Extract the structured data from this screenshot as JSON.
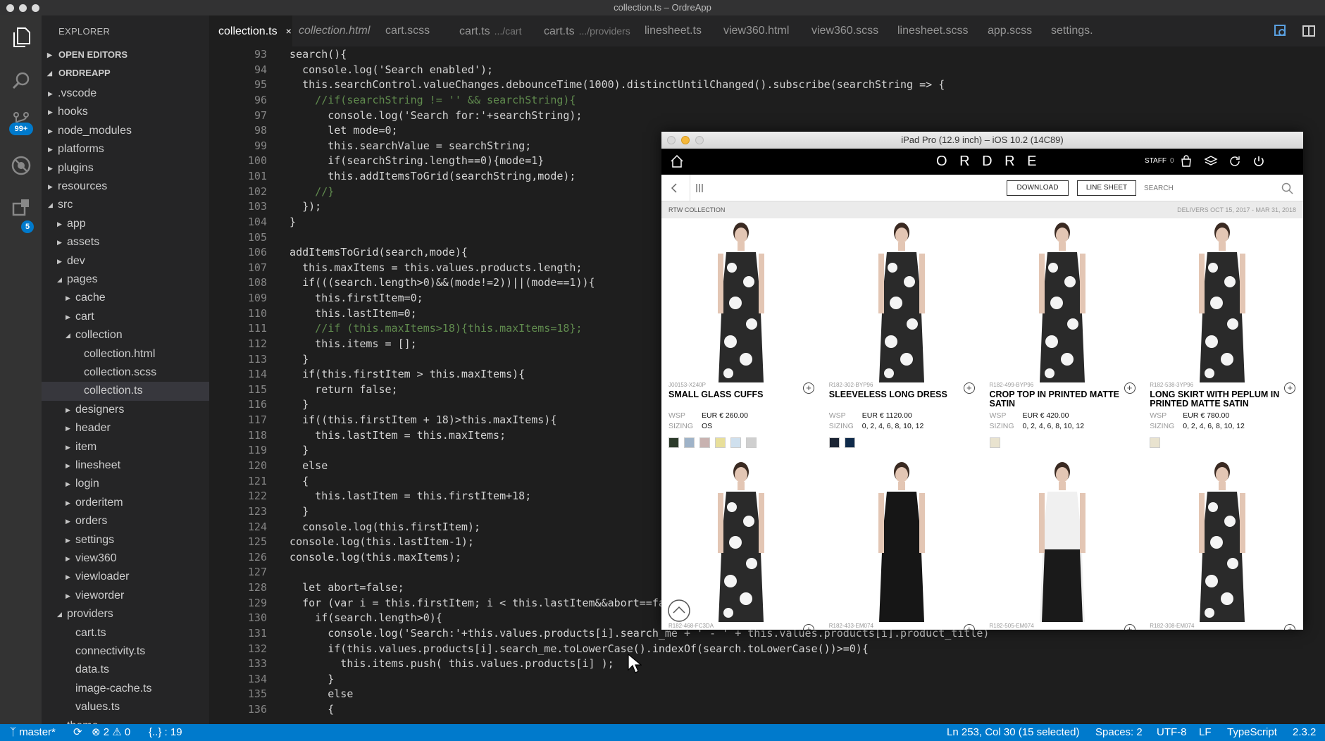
{
  "window": {
    "title": "collection.ts – OrdreApp"
  },
  "activity_bar": {
    "scm_badge": "99+",
    "ext_badge": "5"
  },
  "sidebar": {
    "title": "EXPLORER",
    "open_editors": "OPEN EDITORS",
    "project": "ORDREAPP",
    "tree": [
      {
        "label": ".vscode",
        "depth": 1,
        "kind": "folder",
        "open": false
      },
      {
        "label": "hooks",
        "depth": 1,
        "kind": "folder",
        "open": false
      },
      {
        "label": "node_modules",
        "depth": 1,
        "kind": "folder",
        "open": false
      },
      {
        "label": "platforms",
        "depth": 1,
        "kind": "folder",
        "open": false
      },
      {
        "label": "plugins",
        "depth": 1,
        "kind": "folder",
        "open": false
      },
      {
        "label": "resources",
        "depth": 1,
        "kind": "folder",
        "open": false
      },
      {
        "label": "src",
        "depth": 1,
        "kind": "folder",
        "open": true
      },
      {
        "label": "app",
        "depth": 2,
        "kind": "folder",
        "open": false
      },
      {
        "label": "assets",
        "depth": 2,
        "kind": "folder",
        "open": false
      },
      {
        "label": "dev",
        "depth": 2,
        "kind": "folder",
        "open": false
      },
      {
        "label": "pages",
        "depth": 2,
        "kind": "folder",
        "open": true
      },
      {
        "label": "cache",
        "depth": 3,
        "kind": "folder",
        "open": false
      },
      {
        "label": "cart",
        "depth": 3,
        "kind": "folder",
        "open": false
      },
      {
        "label": "collection",
        "depth": 3,
        "kind": "folder",
        "open": true
      },
      {
        "label": "collection.html",
        "depth": 4,
        "kind": "file"
      },
      {
        "label": "collection.scss",
        "depth": 4,
        "kind": "file"
      },
      {
        "label": "collection.ts",
        "depth": 4,
        "kind": "file",
        "selected": true
      },
      {
        "label": "designers",
        "depth": 3,
        "kind": "folder",
        "open": false
      },
      {
        "label": "header",
        "depth": 3,
        "kind": "folder",
        "open": false
      },
      {
        "label": "item",
        "depth": 3,
        "kind": "folder",
        "open": false
      },
      {
        "label": "linesheet",
        "depth": 3,
        "kind": "folder",
        "open": false
      },
      {
        "label": "login",
        "depth": 3,
        "kind": "folder",
        "open": false
      },
      {
        "label": "orderitem",
        "depth": 3,
        "kind": "folder",
        "open": false
      },
      {
        "label": "orders",
        "depth": 3,
        "kind": "folder",
        "open": false
      },
      {
        "label": "settings",
        "depth": 3,
        "kind": "folder",
        "open": false
      },
      {
        "label": "view360",
        "depth": 3,
        "kind": "folder",
        "open": false
      },
      {
        "label": "viewloader",
        "depth": 3,
        "kind": "folder",
        "open": false
      },
      {
        "label": "vieworder",
        "depth": 3,
        "kind": "folder",
        "open": false
      },
      {
        "label": "providers",
        "depth": 2,
        "kind": "folder",
        "open": true
      },
      {
        "label": "cart.ts",
        "depth": 3,
        "kind": "file"
      },
      {
        "label": "connectivity.ts",
        "depth": 3,
        "kind": "file"
      },
      {
        "label": "data.ts",
        "depth": 3,
        "kind": "file"
      },
      {
        "label": "image-cache.ts",
        "depth": 3,
        "kind": "file"
      },
      {
        "label": "values.ts",
        "depth": 3,
        "kind": "file"
      },
      {
        "label": "theme",
        "depth": 2,
        "kind": "folder",
        "open": false
      }
    ]
  },
  "tabs": [
    {
      "label": "collection.ts",
      "desc": "",
      "active": true,
      "italic": false
    },
    {
      "label": "collection.html",
      "desc": "",
      "active": false,
      "italic": true
    },
    {
      "label": "cart.scss",
      "desc": "",
      "active": false,
      "italic": false
    },
    {
      "label": "cart.ts",
      "desc": ".../cart",
      "active": false,
      "italic": false
    },
    {
      "label": "cart.ts",
      "desc": ".../providers",
      "active": false,
      "italic": false
    },
    {
      "label": "linesheet.ts",
      "desc": "",
      "active": false,
      "italic": false
    },
    {
      "label": "view360.html",
      "desc": "",
      "active": false,
      "italic": false
    },
    {
      "label": "view360.scss",
      "desc": "",
      "active": false,
      "italic": false
    },
    {
      "label": "linesheet.scss",
      "desc": "",
      "active": false,
      "italic": false
    },
    {
      "label": "app.scss",
      "desc": "",
      "active": false,
      "italic": false
    },
    {
      "label": "settings.",
      "desc": "",
      "active": false,
      "italic": false
    }
  ],
  "tab_close_glyph": "×",
  "editor": {
    "first_line": 93,
    "lines": [
      "  search(){",
      "    console.log('Search enabled');",
      "    this.searchControl.valueChanges.debounceTime(1000).distinctUntilChanged().subscribe(searchString => {",
      "      //if(searchString != '' && searchString){",
      "        console.log('Search for:'+searchString);",
      "        let mode=0;",
      "        this.searchValue = searchString;",
      "        if(searchString.length==0){mode=1}",
      "        this.addItemsToGrid(searchString,mode);",
      "      //}",
      "    });",
      "  }",
      "",
      "  addItemsToGrid(search,mode){",
      "    this.maxItems = this.values.products.length;",
      "    if(((search.length>0)&&(mode!=2))||(mode==1)){",
      "      this.firstItem=0;",
      "      this.lastItem=0;",
      "      //if (this.maxItems>18){this.maxItems=18};",
      "      this.items = [];",
      "    }",
      "    if(this.firstItem > this.maxItems){",
      "      return false;",
      "    }",
      "    if((this.firstItem + 18)>this.maxItems){",
      "      this.lastItem = this.maxItems;",
      "    }",
      "    else",
      "    {",
      "      this.lastItem = this.firstItem+18;",
      "    }",
      "    console.log(this.firstItem);",
      "  console.log(this.lastItem-1);",
      "  console.log(this.maxItems);",
      "",
      "    let abort=false;",
      "    for (var i = this.firstItem; i < this.lastItem&&abort==false; i++){",
      "      if(search.length>0){",
      "        console.log('Search:'+this.values.products[i].search_me + ' - ' + this.values.products[i].product_title)",
      "        if(this.values.products[i].search_me.toLowerCase().indexOf(search.toLowerCase())>=0){",
      "          this.items.push( this.values.products[i] );",
      "        }",
      "        else",
      "        {"
    ]
  },
  "simulator": {
    "title": "iPad Pro (12.9 inch) – iOS 10.2 (14C89)",
    "brand": "O R D R E",
    "staff": "STAFF",
    "cart_count": "0",
    "download": "DOWNLOAD",
    "line_sheet": "LINE SHEET",
    "search_placeholder": "SEARCH",
    "collection_label": "RTW COLLECTION",
    "delivers": "DELIVERS OCT 15, 2017 - MAR 31, 2018",
    "wsp_label": "WSP",
    "sizing_label": "SIZING",
    "products": [
      {
        "code": "J00153-X240P",
        "name": "SMALL GLASS CUFFS",
        "wsp": "EUR € 260.00",
        "sizing": "OS",
        "swatches": [
          "#2b3a2a",
          "#9fb3c8",
          "#c8b2b0",
          "#e8df9a",
          "#cfe0ee",
          "#cfcfcf"
        ]
      },
      {
        "code": "R182-302-BYP96",
        "name": "SLEEVELESS LONG DRESS",
        "wsp": "EUR € 1120.00",
        "sizing": "0, 2, 4, 6, 8, 10, 12",
        "swatches": [
          "#1b2433",
          "#0f2a4a"
        ]
      },
      {
        "code": "R182-499-BYP96",
        "name": "CROP TOP IN PRINTED MATTE SATIN",
        "wsp": "EUR € 420.00",
        "sizing": "0, 2, 4, 6, 8, 10, 12",
        "swatches": [
          "#e9e3cf"
        ]
      },
      {
        "code": "R182-538-3YP96",
        "name": "LONG SKIRT WITH PEPLUM IN PRINTED MATTE SATIN",
        "wsp": "EUR € 780.00",
        "sizing": "0, 2, 4, 6, 8, 10, 12",
        "swatches": [
          "#e9e3cf"
        ]
      },
      {
        "code": "R182-468-FC3DA",
        "name": "",
        "wsp": "",
        "sizing": "",
        "swatches": []
      },
      {
        "code": "R182-433-EM074",
        "name": "",
        "wsp": "",
        "sizing": "",
        "swatches": []
      },
      {
        "code": "R182-505-EM074",
        "name": "",
        "wsp": "",
        "sizing": "",
        "swatches": []
      },
      {
        "code": "R182-308-EM074",
        "name": "",
        "wsp": "",
        "sizing": "",
        "swatches": []
      }
    ]
  },
  "status_bar": {
    "branch": "master*",
    "errors": "2",
    "warnings": "0",
    "braces": "{..} : 19",
    "position": "Ln 253, Col 30 (15 selected)",
    "spaces": "Spaces: 2",
    "encoding": "UTF-8",
    "eol": "LF",
    "language": "TypeScript",
    "version": "2.3.2"
  }
}
